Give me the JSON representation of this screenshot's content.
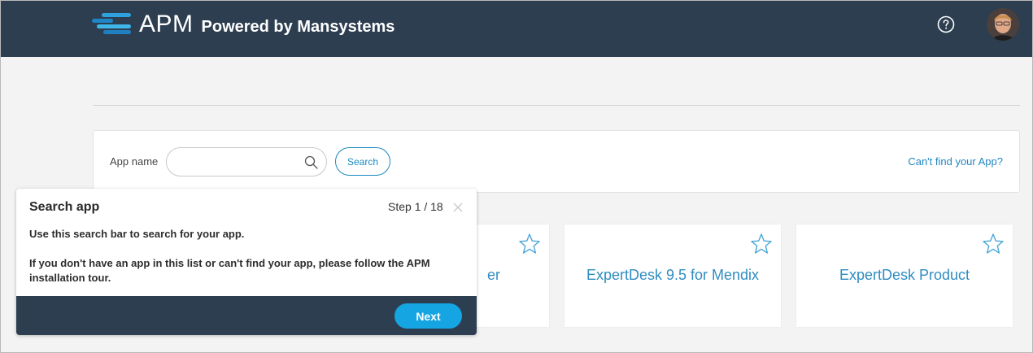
{
  "header": {
    "logo_text": "APM",
    "powered_by": "Powered by Mansystems",
    "help_icon": "question-circle-icon",
    "avatar": "user-avatar"
  },
  "search": {
    "label": "App name",
    "input_value": "",
    "search_button": "Search",
    "cant_find_link": "Can't find your App?"
  },
  "apps": [
    {
      "name": "er"
    },
    {
      "name": "ExpertDesk 9.5 for Mendix"
    },
    {
      "name": "ExpertDesk Product"
    }
  ],
  "tour": {
    "title": "Search app",
    "step": "Step 1 / 18",
    "paragraph1": "Use this search bar to search for your app.",
    "paragraph2": "If you don't have an app in this list or can't find your app, please follow the APM installation tour.",
    "next_button": "Next"
  },
  "colors": {
    "header_bg": "#2d3e50",
    "accent": "#15a5e2",
    "link": "#1f86c2"
  }
}
